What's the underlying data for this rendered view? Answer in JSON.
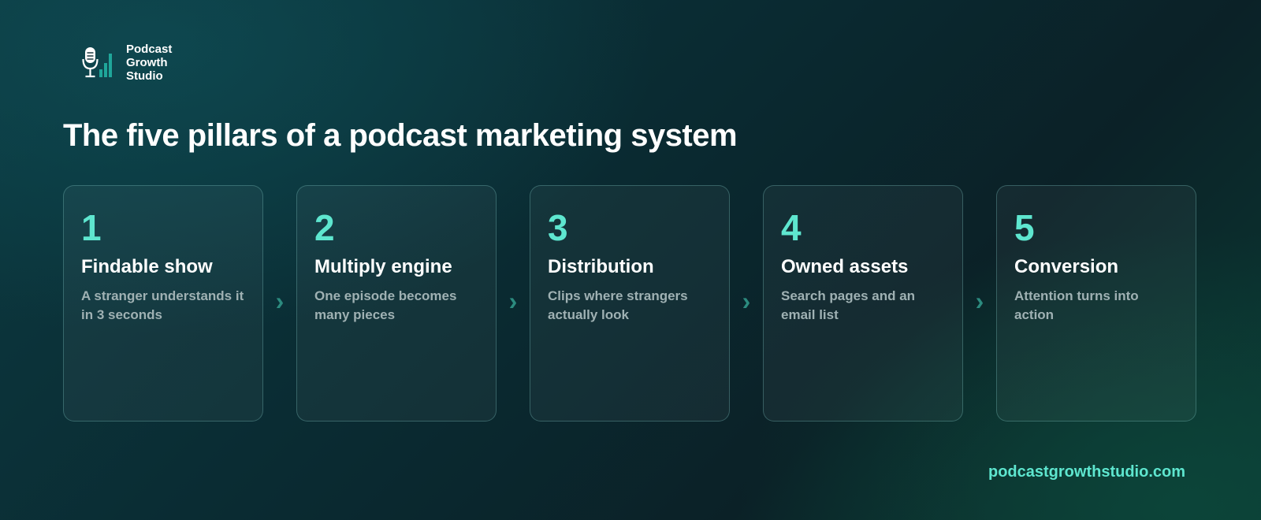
{
  "brand": {
    "name_lines": [
      "Podcast",
      "Growth",
      "Studio"
    ],
    "icon": "microphone-bars-icon",
    "accent_color": "#5ee6cf"
  },
  "title": "The five pillars of a podcast marketing system",
  "pillars": [
    {
      "number": "1",
      "title": "Findable show",
      "description": "A stranger understands it in 3 seconds"
    },
    {
      "number": "2",
      "title": "Multiply engine",
      "description": "One episode becomes many pieces"
    },
    {
      "number": "3",
      "title": "Distribution",
      "description": "Clips where strangers actually look"
    },
    {
      "number": "4",
      "title": "Owned assets",
      "description": "Search pages and an email list"
    },
    {
      "number": "5",
      "title": "Conversion",
      "description": "Attention turns into action"
    }
  ],
  "arrow_glyph": "›",
  "footer": {
    "url": "podcastgrowthstudio.com"
  }
}
